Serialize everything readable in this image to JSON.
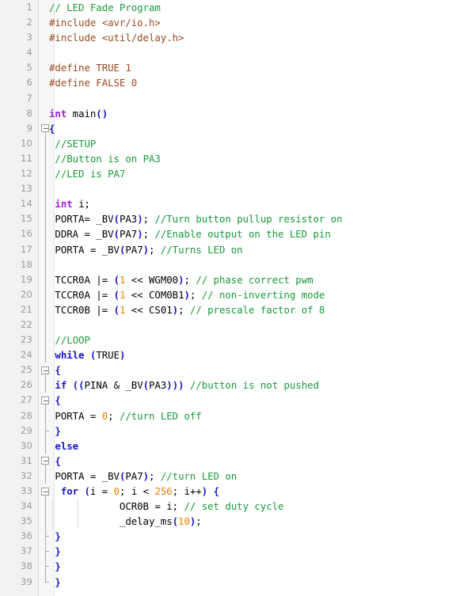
{
  "editor": {
    "language": "C",
    "gutter_bg": "#f2f2f2",
    "fold_bg": "#f7f7f7",
    "colors": {
      "comment": "#1a9a3c",
      "preprocessor": "#9a4a20",
      "keyword": "#1616c8",
      "type": "#a020d0",
      "number": "#ee8000",
      "plain": "#000000",
      "line_number": "#9a9a9a",
      "background": "#ffffff"
    },
    "total_lines": 39,
    "lines": [
      {
        "n": "1",
        "fold": "none",
        "indent": 0,
        "text": "// LED Fade Program"
      },
      {
        "n": "2",
        "fold": "none",
        "indent": 0,
        "text": "#include <avr/io.h>"
      },
      {
        "n": "3",
        "fold": "none",
        "indent": 0,
        "text": "#include <util/delay.h>"
      },
      {
        "n": "4",
        "fold": "none",
        "indent": 0,
        "text": ""
      },
      {
        "n": "5",
        "fold": "none",
        "indent": 0,
        "text": "#define TRUE 1"
      },
      {
        "n": "6",
        "fold": "none",
        "indent": 0,
        "text": "#define FALSE 0"
      },
      {
        "n": "7",
        "fold": "none",
        "indent": 0,
        "text": ""
      },
      {
        "n": "8",
        "fold": "none",
        "indent": 0,
        "text": "int main()"
      },
      {
        "n": "9",
        "fold": "box",
        "indent": 0,
        "text": "{"
      },
      {
        "n": "10",
        "fold": "line",
        "indent": 0,
        "text": " //SETUP"
      },
      {
        "n": "11",
        "fold": "line",
        "indent": 0,
        "text": " //Button is on PA3"
      },
      {
        "n": "12",
        "fold": "line",
        "indent": 0,
        "text": " //LED is PA7"
      },
      {
        "n": "13",
        "fold": "line",
        "indent": 0,
        "text": ""
      },
      {
        "n": "14",
        "fold": "line",
        "indent": 0,
        "text": " int i;"
      },
      {
        "n": "15",
        "fold": "line",
        "indent": 0,
        "text": " PORTA= _BV(PA3); //Turn button pullup resistor on"
      },
      {
        "n": "16",
        "fold": "line",
        "indent": 0,
        "text": " DDRA = _BV(PA7); //Enable output on the LED pin"
      },
      {
        "n": "17",
        "fold": "line",
        "indent": 0,
        "text": " PORTA = _BV(PA7); //Turns LED on"
      },
      {
        "n": "18",
        "fold": "line",
        "indent": 0,
        "text": ""
      },
      {
        "n": "19",
        "fold": "line",
        "indent": 0,
        "text": " TCCR0A |= (1 << WGM00); // phase correct pwm"
      },
      {
        "n": "20",
        "fold": "line",
        "indent": 0,
        "text": " TCCR0A |= (1 << COM0B1); // non-inverting mode"
      },
      {
        "n": "21",
        "fold": "line",
        "indent": 0,
        "text": " TCCR0B |= (1 << CS01); // prescale factor of 8"
      },
      {
        "n": "22",
        "fold": "line",
        "indent": 0,
        "text": ""
      },
      {
        "n": "23",
        "fold": "line",
        "indent": 0,
        "text": " //LOOP"
      },
      {
        "n": "24",
        "fold": "line",
        "indent": 0,
        "text": " while (TRUE)"
      },
      {
        "n": "25",
        "fold": "box",
        "indent": 0,
        "text": " {"
      },
      {
        "n": "26",
        "fold": "line",
        "indent": 1,
        "text": " if ((PINA & _BV(PA3))) //button is not pushed"
      },
      {
        "n": "27",
        "fold": "box",
        "indent": 0,
        "text": " {"
      },
      {
        "n": "28",
        "fold": "line",
        "indent": 1,
        "text": " PORTA = 0; //turn LED off"
      },
      {
        "n": "29",
        "fold": "tick",
        "indent": 0,
        "text": " }"
      },
      {
        "n": "30",
        "fold": "line",
        "indent": 1,
        "text": " else"
      },
      {
        "n": "31",
        "fold": "box",
        "indent": 0,
        "text": " {"
      },
      {
        "n": "32",
        "fold": "line",
        "indent": 1,
        "text": " PORTA = _BV(PA7); //turn LED on"
      },
      {
        "n": "33",
        "fold": "box",
        "indent": 1,
        "text": "  for (i = 0; i < 256; i++) {"
      },
      {
        "n": "34",
        "fold": "line",
        "indent": 3,
        "text": "            OCR0B = i; // set duty cycle"
      },
      {
        "n": "35",
        "fold": "line",
        "indent": 3,
        "text": "            _delay_ms(10);"
      },
      {
        "n": "36",
        "fold": "tick",
        "indent": 0,
        "text": " }"
      },
      {
        "n": "37",
        "fold": "tick",
        "indent": 0,
        "text": " }"
      },
      {
        "n": "38",
        "fold": "tick",
        "indent": 0,
        "text": " }"
      },
      {
        "n": "39",
        "fold": "end",
        "indent": 0,
        "text": " }"
      }
    ]
  }
}
